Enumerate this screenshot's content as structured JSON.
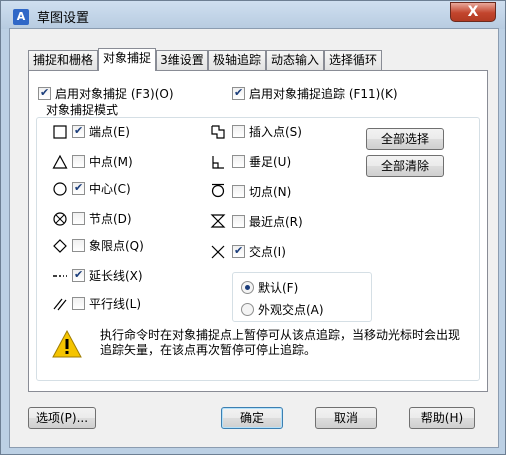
{
  "window": {
    "title": "草图设置",
    "close_label": "X",
    "app_icon": "drafting-app-icon"
  },
  "tabs": [
    {
      "label": "捕捉和栅格",
      "active": false
    },
    {
      "label": "对象捕捉",
      "active": true
    },
    {
      "label": "3维设置",
      "active": false
    },
    {
      "label": "极轴追踪",
      "active": false
    },
    {
      "label": "动态输入",
      "active": false
    },
    {
      "label": "选择循环",
      "active": false
    }
  ],
  "enable_osnap": {
    "label": "启用对象捕捉 (F3)(O)",
    "checked": true
  },
  "enable_tracking": {
    "label": "启用对象捕捉追踪 (F11)(K)",
    "checked": true
  },
  "group_label": "对象捕捉模式",
  "left_modes": [
    {
      "label": "端点(E)",
      "checked": true,
      "icon": "square-endpoint-icon"
    },
    {
      "label": "中点(M)",
      "checked": false,
      "icon": "triangle-midpoint-icon"
    },
    {
      "label": "中心(C)",
      "checked": true,
      "icon": "circle-center-icon"
    },
    {
      "label": "节点(D)",
      "checked": false,
      "icon": "node-icon"
    },
    {
      "label": "象限点(Q)",
      "checked": false,
      "icon": "diamond-quadrant-icon"
    },
    {
      "label": "延长线(X)",
      "checked": true,
      "icon": "extension-icon"
    },
    {
      "label": "平行线(L)",
      "checked": false,
      "icon": "parallel-icon"
    }
  ],
  "right_modes": [
    {
      "label": "插入点(S)",
      "checked": false,
      "icon": "insertion-icon"
    },
    {
      "label": "垂足(U)",
      "checked": false,
      "icon": "perpendicular-icon"
    },
    {
      "label": "切点(N)",
      "checked": false,
      "icon": "tangent-icon"
    },
    {
      "label": "最近点(R)",
      "checked": false,
      "icon": "nearest-icon"
    },
    {
      "label": "交点(I)",
      "checked": true,
      "icon": "intersection-icon"
    }
  ],
  "select_all": "全部选择",
  "clear_all": "全部清除",
  "radios": [
    {
      "label": "默认(F)",
      "checked": true
    },
    {
      "label": "外观交点(A)",
      "checked": false
    }
  ],
  "message": "执行命令时在对象捕捉点上暂停可从该点追踪，当移动光标时会出现追踪矢量，在该点再次暂停可停止追踪。",
  "buttons": {
    "options": "选项(P)...",
    "ok": "确定",
    "cancel": "取消",
    "help": "帮助(H)"
  }
}
